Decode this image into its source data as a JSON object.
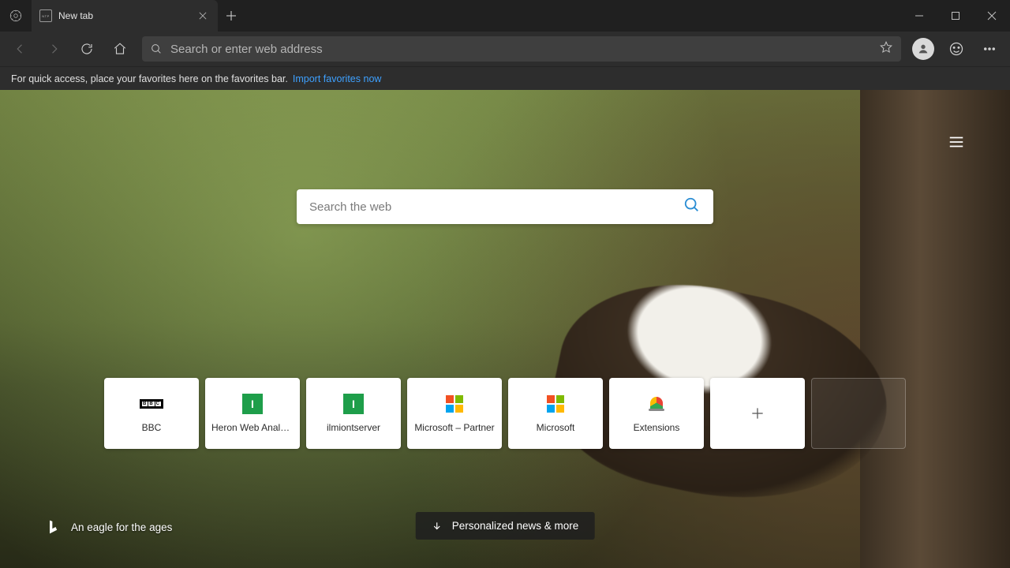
{
  "tab": {
    "label": "New tab"
  },
  "addressbar": {
    "placeholder": "Search or enter web address"
  },
  "favbar": {
    "msg": "For quick access, place your favorites here on the favorites bar.",
    "link": "Import favorites now"
  },
  "search": {
    "placeholder": "Search the web"
  },
  "tiles": [
    {
      "label": "BBC",
      "icon": "bbc"
    },
    {
      "label": "Heron Web Analytics",
      "icon": "green-i"
    },
    {
      "label": "ilmiontserver",
      "icon": "green-i"
    },
    {
      "label": "Microsoft – Partner",
      "icon": "ms"
    },
    {
      "label": "Microsoft",
      "icon": "ms"
    },
    {
      "label": "Extensions",
      "icon": "ext"
    }
  ],
  "caption": "An eagle for the ages",
  "newsbtn": "Personalized news & more"
}
